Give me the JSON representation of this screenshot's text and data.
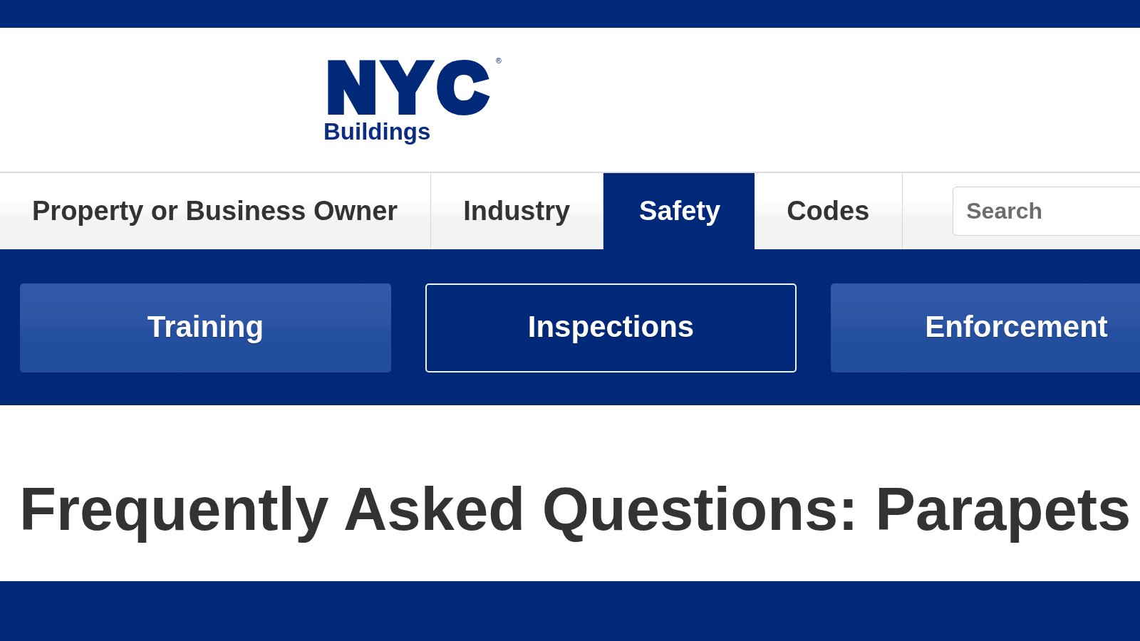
{
  "logo": {
    "wordmark": "NYC",
    "registered_mark": "®",
    "subtitle": "Buildings"
  },
  "main_nav": {
    "items": [
      {
        "label": "Property or Business Owner",
        "selected": false
      },
      {
        "label": "Industry",
        "selected": false
      },
      {
        "label": "Safety",
        "selected": true
      },
      {
        "label": "Codes",
        "selected": false
      }
    ],
    "search": {
      "placeholder": "Search"
    }
  },
  "sub_nav": {
    "items": [
      {
        "label": "Training",
        "selected": false
      },
      {
        "label": "Inspections",
        "selected": true
      },
      {
        "label": "Enforcement",
        "selected": false
      }
    ]
  },
  "page_title": "Frequently Asked Questions: Parapets"
}
